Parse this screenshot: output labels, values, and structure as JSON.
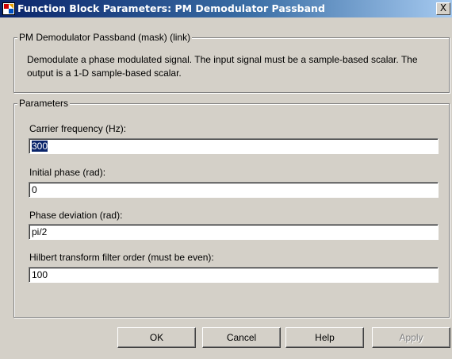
{
  "window": {
    "title": "Function Block Parameters: PM Demodulator Passband",
    "close_glyph": "X"
  },
  "mask_group": {
    "label": "PM Demodulator Passband (mask) (link)",
    "description": "Demodulate a phase modulated signal. The input signal must be a sample-based scalar. The output is a 1-D sample-based scalar."
  },
  "parameters_group": {
    "label": "Parameters",
    "fields": [
      {
        "label": "Carrier frequency (Hz):",
        "value": "300"
      },
      {
        "label": "Initial phase (rad):",
        "value": "0"
      },
      {
        "label": "Phase deviation (rad):",
        "value": "pi/2"
      },
      {
        "label": "Hilbert transform filter order (must be even):",
        "value": "100"
      }
    ]
  },
  "buttons": {
    "ok": "OK",
    "cancel": "Cancel",
    "help": "Help",
    "apply": "Apply"
  }
}
